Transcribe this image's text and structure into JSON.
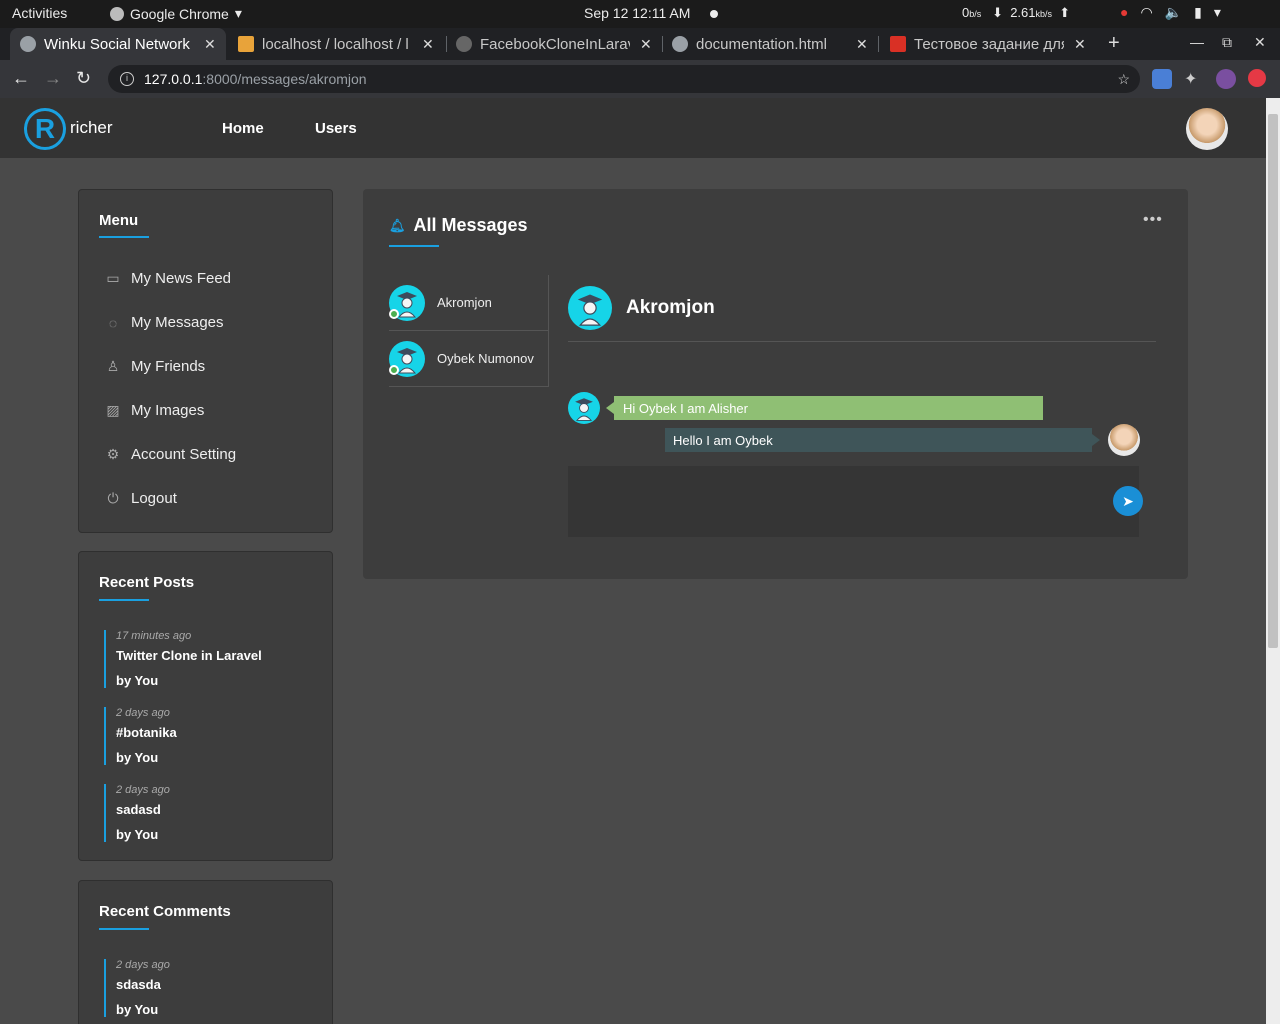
{
  "os": {
    "activities": "Activities",
    "app_name": "Google Chrome",
    "clock": "Sep 12  12:11 AM",
    "net_down": "0",
    "net_down_unit": "b/s",
    "net_up": "2.61",
    "net_up_unit": "kb/s"
  },
  "browser": {
    "tabs": [
      {
        "title": "Winku Social Network"
      },
      {
        "title": "localhost / localhost / l"
      },
      {
        "title": "FacebookCloneInLarav"
      },
      {
        "title": "documentation.html"
      },
      {
        "title": "Тестовое задание для"
      }
    ],
    "url_host": "127.0.0.1",
    "url_path": ":8000/messages/akromjon"
  },
  "site": {
    "brand": "richer",
    "logo_letter": "R",
    "nav": [
      "Home",
      "Users"
    ]
  },
  "menu": {
    "title": "Menu",
    "items": [
      {
        "label": "My News Feed",
        "icon": "clipboard-icon"
      },
      {
        "label": "My Messages",
        "icon": "chat-icon"
      },
      {
        "label": "My Friends",
        "icon": "user-icon"
      },
      {
        "label": "My Images",
        "icon": "image-icon"
      },
      {
        "label": "Account Setting",
        "icon": "gear-icon"
      },
      {
        "label": "Logout",
        "icon": "power-icon"
      }
    ]
  },
  "recent_posts": {
    "title": "Recent Posts",
    "items": [
      {
        "time": "17 minutes ago",
        "title": "Twitter Clone in Laravel",
        "by": "by You"
      },
      {
        "time": "2 days ago",
        "title": "#botanika",
        "by": "by You"
      },
      {
        "time": "2 days ago",
        "title": "sadasd",
        "by": "by You"
      }
    ]
  },
  "recent_comments": {
    "title": "Recent Comments",
    "items": [
      {
        "time": "2 days ago",
        "title": "sdasda",
        "by": "by You"
      }
    ]
  },
  "messages": {
    "title": "All Messages",
    "more": "•••",
    "conversations": [
      {
        "name": "Akromjon",
        "online": true
      },
      {
        "name": "Oybek Numonov",
        "online": true
      }
    ],
    "active_chat": {
      "name": "Akromjon",
      "incoming": "Hi Oybek I am Alisher",
      "outgoing": "Hello I am Oybek"
    }
  },
  "colors": {
    "accent": "#1aa0e0",
    "incoming_bubble": "#8fbf74",
    "outgoing_bubble": "#3f5559",
    "avatar_bg": "#16d4e8"
  }
}
